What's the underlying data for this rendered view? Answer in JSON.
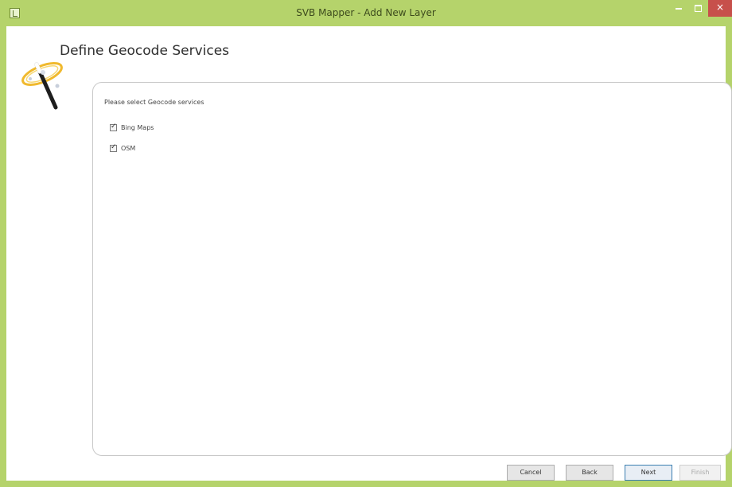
{
  "window": {
    "title": "SVB Mapper - Add New Layer",
    "accent_color": "#b5d36b",
    "close_color": "#c7504b",
    "min_icon": "minimize-icon",
    "max_icon": "maximize-icon",
    "close_icon": "close-icon",
    "close_glyph": "×"
  },
  "page": {
    "heading": "Define Geocode Services",
    "wizard_icon": "magic-wand-icon"
  },
  "panel": {
    "prompt": "Please select Geocode services",
    "services": [
      {
        "label": "Bing Maps",
        "checked": true
      },
      {
        "label": "OSM",
        "checked": true
      }
    ]
  },
  "buttons": {
    "cancel": "Cancel",
    "back": "Back",
    "next": "Next",
    "finish": "Finish"
  }
}
